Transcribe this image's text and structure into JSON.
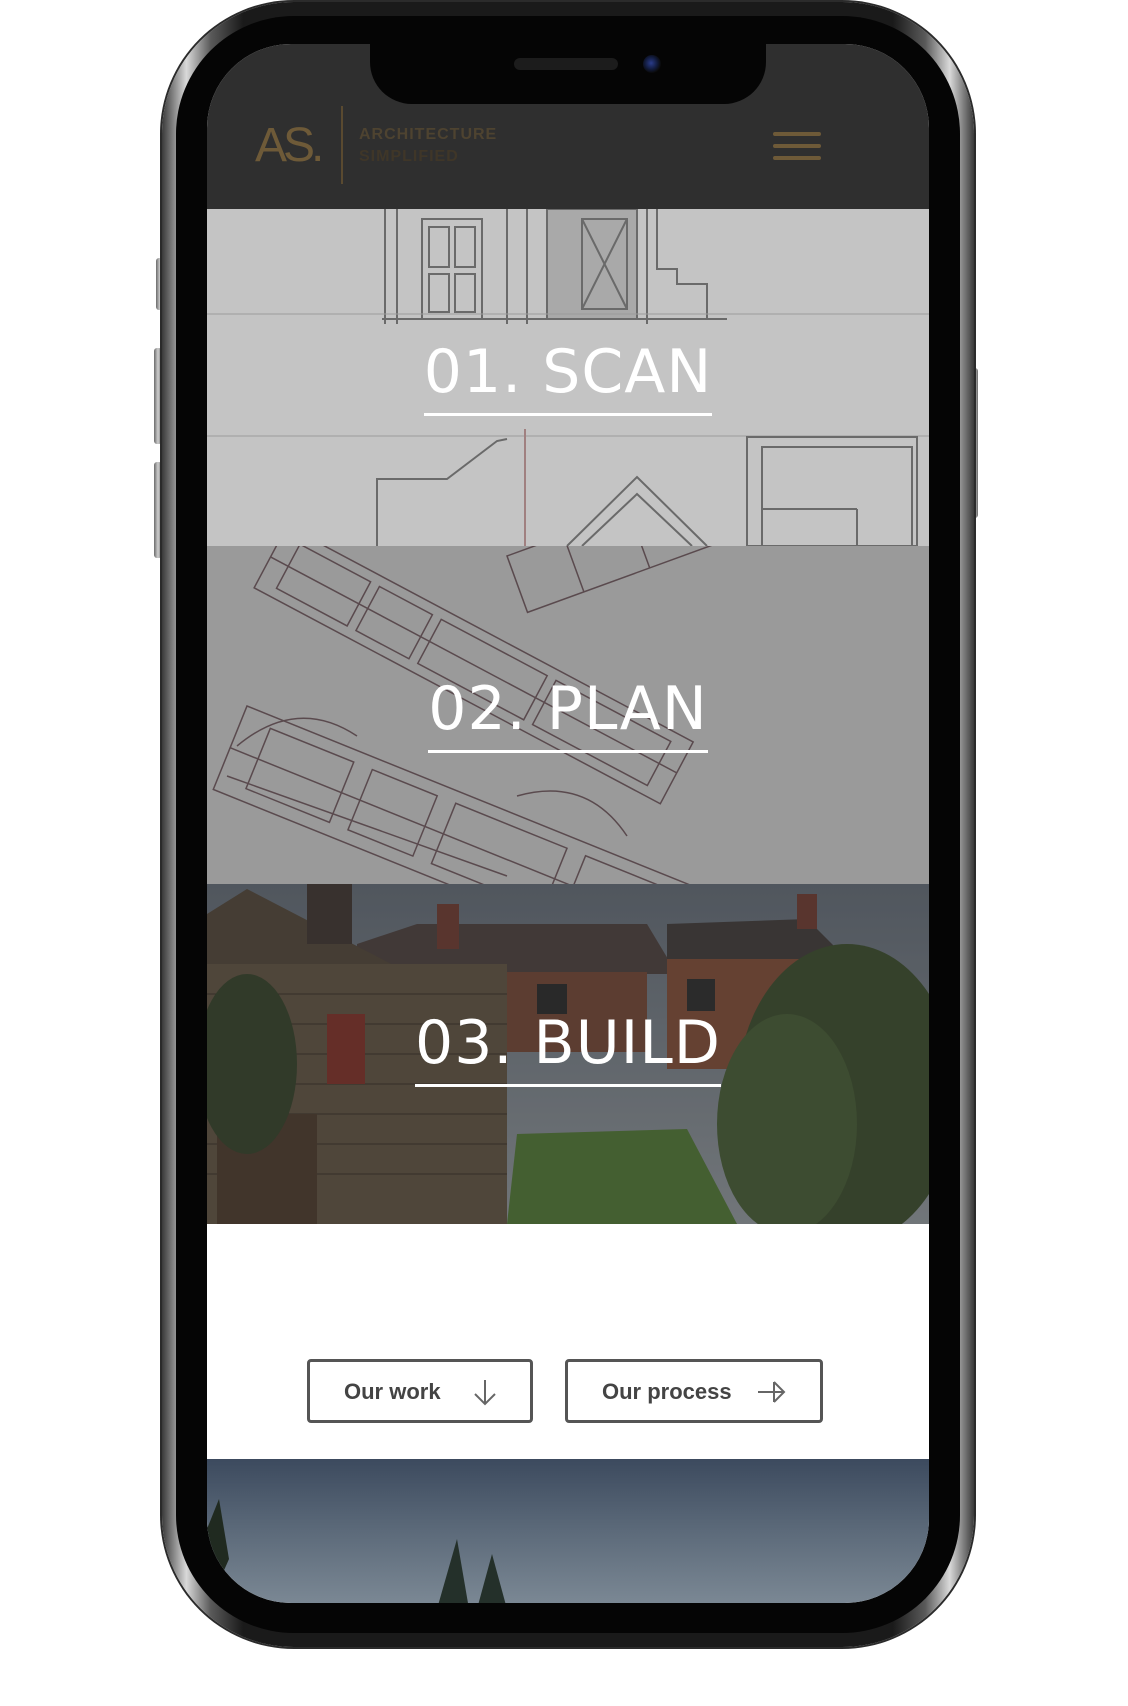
{
  "header": {
    "logo_mark": "AS.",
    "logo_line1": "ARCHITECTURE",
    "logo_line2": "SIMPLIFIED",
    "menu_icon": "hamburger-icon",
    "background": "#2f2f2f",
    "accent": "#6e5a38"
  },
  "panels": [
    {
      "title": "01. SCAN",
      "background": "#c4c4c4"
    },
    {
      "title": "02. PLAN",
      "background": "#9a9a9a"
    },
    {
      "title": "03. BUILD",
      "background": "#4b4e50"
    }
  ],
  "actions": {
    "our_work": {
      "label": "Our work",
      "icon": "arrow-down-icon"
    },
    "our_process": {
      "label": "Our process",
      "icon": "arrow-right-icon"
    }
  }
}
